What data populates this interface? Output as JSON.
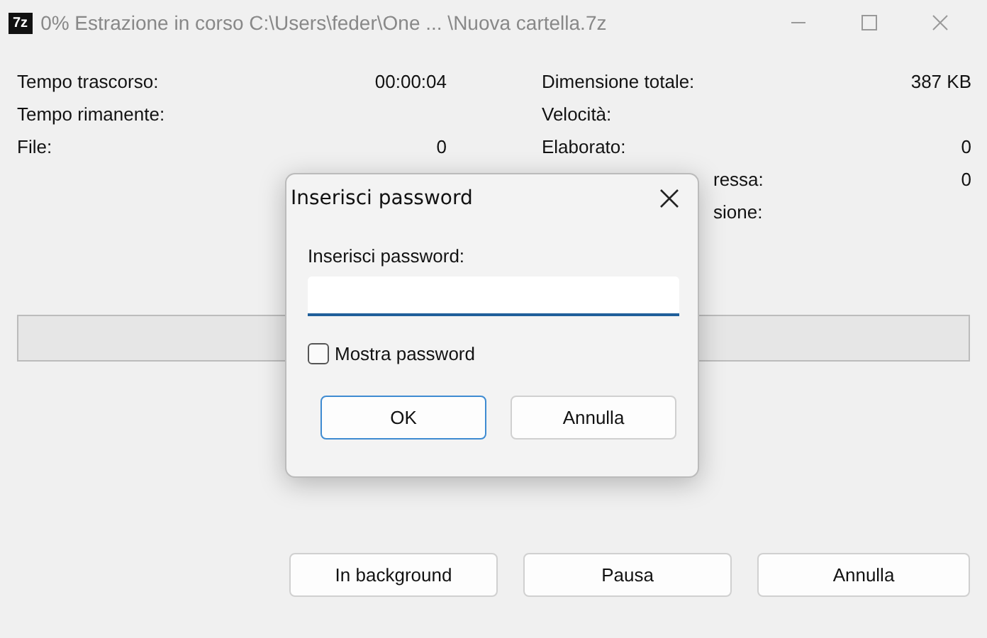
{
  "window": {
    "app_icon": "7z",
    "title": "0% Estrazione in corso C:\\Users\\feder\\One ... \\Nuova cartella.7z"
  },
  "stats_left": [
    {
      "label": "Tempo trascorso:",
      "value": "00:00:04"
    },
    {
      "label": "Tempo rimanente:"
    },
    {
      "label": "File:",
      "value": "0"
    }
  ],
  "stats_right": [
    {
      "kind": "full",
      "label": "Dimensione totale:",
      "value": "387 KB"
    },
    {
      "kind": "full",
      "label": "Velocità:"
    },
    {
      "kind": "full",
      "label": "Elaborato:",
      "value": "0"
    },
    {
      "kind": "covered",
      "label": "ressa:",
      "value": "0"
    },
    {
      "kind": "covered",
      "label": "sione:"
    }
  ],
  "progress": {
    "level": 0
  },
  "buttons": [
    "In background",
    "Pausa",
    "Annulla"
  ],
  "dialog": {
    "title": "Inserisci password",
    "field_label": "Inserisci password:",
    "show_password": {
      "label": "Mostra password",
      "checked": false
    },
    "buttons": [
      "OK",
      "Annulla"
    ]
  }
}
